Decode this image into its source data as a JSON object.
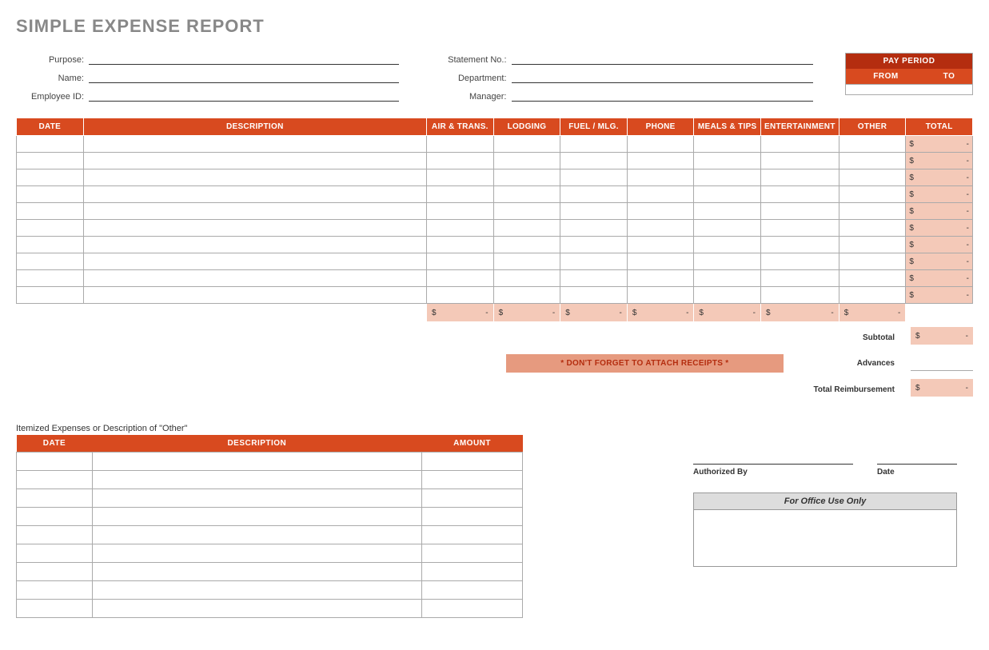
{
  "title": "SIMPLE EXPENSE REPORT",
  "fields": {
    "purpose": "Purpose:",
    "name": "Name:",
    "employee_id": "Employee ID:",
    "statement_no": "Statement No.:",
    "department": "Department:",
    "manager": "Manager:"
  },
  "pay_period": {
    "header": "PAY PERIOD",
    "from": "FROM",
    "to": "TO"
  },
  "main_table": {
    "headers": [
      "DATE",
      "DESCRIPTION",
      "AIR & TRANS.",
      "LODGING",
      "FUEL / MLG.",
      "PHONE",
      "MEALS & TIPS",
      "ENTERTAINMENT",
      "OTHER",
      "TOTAL"
    ],
    "row_total_currency": "$",
    "row_total_value": "-",
    "num_rows": 10,
    "col_sum_currency": "$",
    "col_sum_value": "-"
  },
  "reminder": "* DON'T FORGET TO ATTACH RECEIPTS *",
  "summary": {
    "subtotal_label": "Subtotal",
    "advances_label": "Advances",
    "total_reimbursement_label": "Total Reimbursement",
    "currency": "$",
    "dash": "-"
  },
  "itemized": {
    "label": "Itemized Expenses or Description of \"Other\"",
    "headers": [
      "DATE",
      "DESCRIPTION",
      "AMOUNT"
    ],
    "num_rows": 9
  },
  "signature": {
    "authorized_by": "Authorized By",
    "date": "Date"
  },
  "office": {
    "header": "For Office Use Only"
  }
}
